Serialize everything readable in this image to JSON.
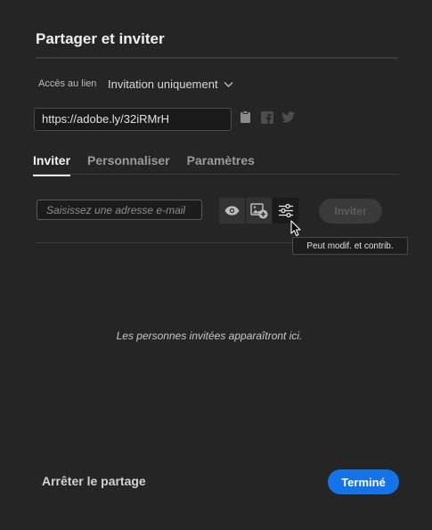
{
  "dialog": {
    "title": "Partager et inviter"
  },
  "access": {
    "label": "Accès au lien",
    "value": "Invitation uniquement"
  },
  "link": {
    "url": "https://adobe.ly/32iRMrH"
  },
  "share_icons": [
    "clipboard-icon",
    "facebook-icon",
    "twitter-icon"
  ],
  "tabs": [
    {
      "label": "Inviter",
      "active": true
    },
    {
      "label": "Personnaliser",
      "active": false
    },
    {
      "label": "Paramètres",
      "active": false
    }
  ],
  "invite": {
    "email_placeholder": "Saisissez une adresse e-mail",
    "button_label": "Inviter",
    "permission_icons": [
      "eye-icon",
      "add-image-icon",
      "sliders-icon"
    ],
    "tooltip": "Peut modif. et contrib."
  },
  "empty_state": "Les personnes invitées apparaîtront ici.",
  "footer": {
    "stop_label": "Arrêter le partage",
    "done_label": "Terminé"
  },
  "colors": {
    "accent": "#1473e6",
    "background": "#252525"
  }
}
